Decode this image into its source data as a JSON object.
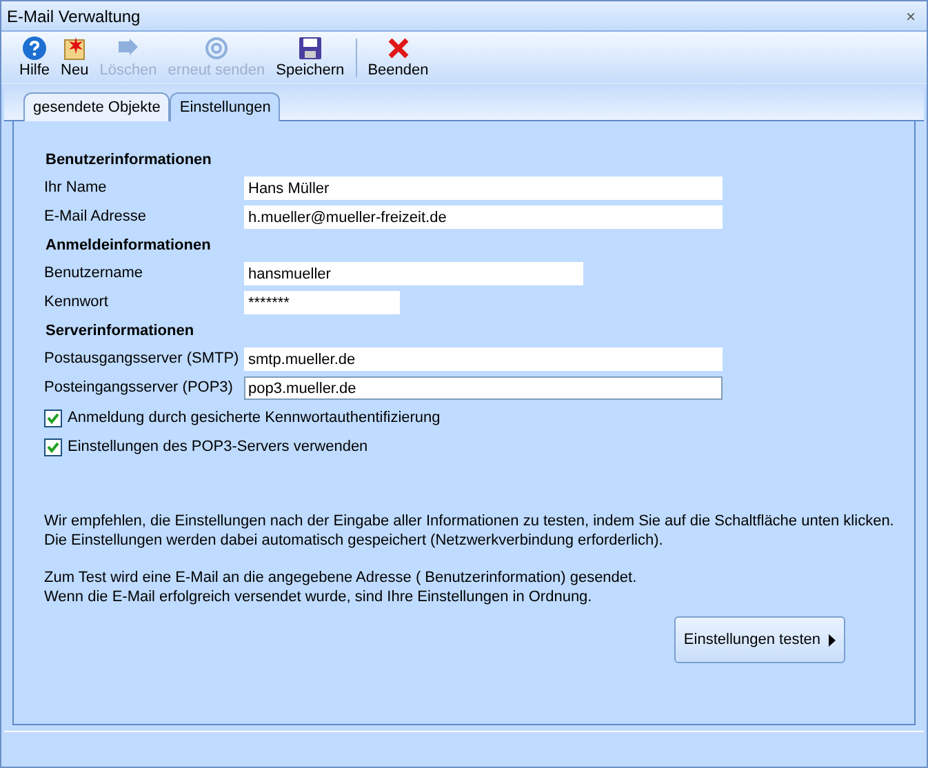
{
  "window": {
    "title": "E-Mail Verwaltung",
    "close": "×"
  },
  "toolbar": [
    {
      "label": "Hilfe",
      "kind": "help",
      "disabled": false
    },
    {
      "label": "Neu",
      "kind": "new",
      "disabled": false
    },
    {
      "label": "Löschen",
      "kind": "delete",
      "disabled": true
    },
    {
      "label": "erneut senden",
      "kind": "resend",
      "disabled": true
    },
    {
      "label": "Speichern",
      "kind": "save",
      "disabled": false
    },
    {
      "label": "Beenden",
      "kind": "exit",
      "disabled": false
    }
  ],
  "tabs": [
    {
      "label": "gesendete Objekte",
      "selected": false
    },
    {
      "label": "Einstellungen",
      "selected": true
    }
  ],
  "sections": [
    {
      "title": "Benutzerinformationen",
      "fields": [
        {
          "label": "Ihr Name",
          "value": "Hans Müller",
          "focused": false
        },
        {
          "label": "E-Mail Adresse",
          "value": "h.mueller@mueller-freizeit.de",
          "focused": false
        }
      ]
    },
    {
      "title": "Anmeldeinformationen",
      "fields": [
        {
          "label": "Benutzername",
          "value": "hansmueller",
          "focused": false
        },
        {
          "label": "Kennwort",
          "value": "*******",
          "focused": false
        }
      ]
    },
    {
      "title": "Serverinformationen",
      "fields": [
        {
          "label": "Postausgangsserver (SMTP)",
          "value": "smtp.mueller.de",
          "focused": false
        },
        {
          "label": "Posteingangsserver (POP3)",
          "value": "pop3.mueller.de",
          "focused": true
        }
      ]
    }
  ],
  "checkboxes": [
    {
      "label": "Anmeldung durch gesicherte Kennwortauthentifizierung",
      "checked": true
    },
    {
      "label": "Einstellungen des POP3-Servers verwenden",
      "checked": true
    }
  ],
  "info_paragraphs": [
    [
      "Wir empfehlen, die Einstellungen nach der Eingabe aller Informationen zu testen, indem Sie auf die Schaltfläche unten klicken.",
      "Die Einstellungen werden dabei automatisch gespeichert (Netzwerkverbindung erforderlich)."
    ],
    [
      "Zum Test wird eine E-Mail an die angegebene Adresse ( Benutzerinformation) gesendet.",
      "Wenn die E-Mail erfolgreich versendet wurde, sind Ihre Einstellungen in Ordnung."
    ]
  ],
  "test_button": {
    "label": "Einstellungen testen"
  }
}
